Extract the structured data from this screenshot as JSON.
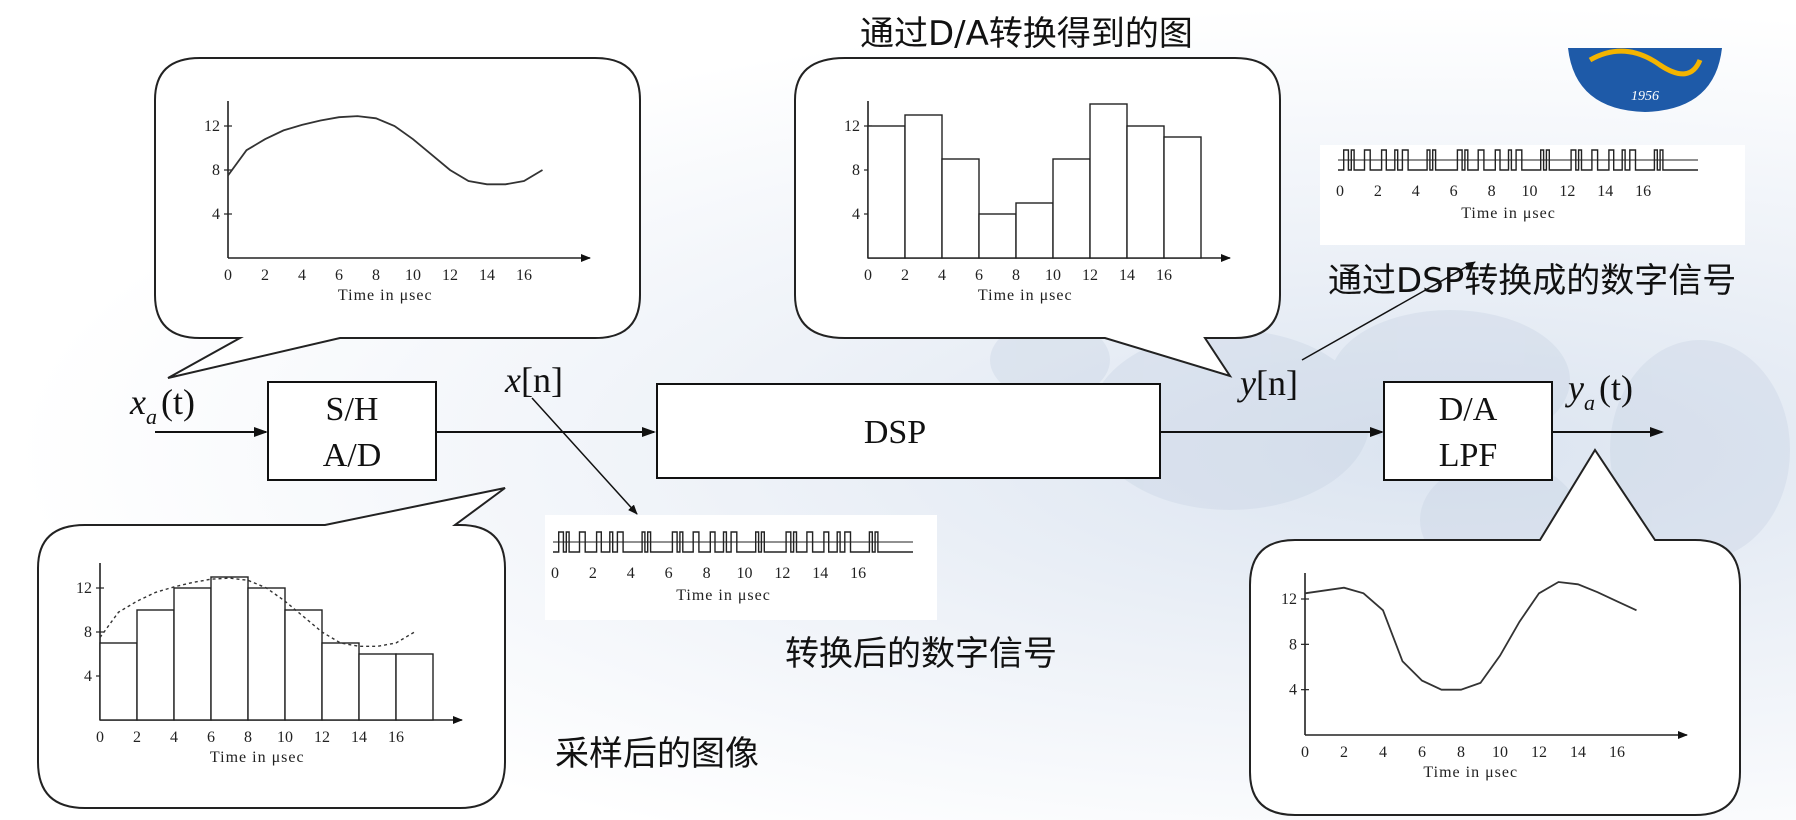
{
  "captions": {
    "da_graph": "通过D/A转换得到的图",
    "dsp_digital": "通过DSP转换成的数字信号",
    "converted_digital": "转换后的数字信号",
    "sampled_image": "采样后的图像"
  },
  "blocks": {
    "sh": {
      "line1": "S/H",
      "line2": "A/D"
    },
    "dsp": {
      "line1": "DSP"
    },
    "da": {
      "line1": "D/A",
      "line2": "LPF"
    }
  },
  "signals": {
    "xa": {
      "base": "x",
      "sub": "a",
      "arg": "(t)"
    },
    "xn": {
      "base": "x",
      "bracket": "[n]"
    },
    "yn": {
      "base": "y",
      "bracket": "[n]"
    },
    "ya": {
      "base": "y",
      "sub": "a",
      "arg": "(t)"
    }
  },
  "logo": {
    "year": "1956"
  },
  "plots": {
    "xticks": [
      "0",
      "2",
      "4",
      "6",
      "8",
      "10",
      "12",
      "14",
      "16"
    ],
    "yticks": [
      "4",
      "8",
      "12"
    ],
    "xlabel": "Time in μsec"
  },
  "chart_data": [
    {
      "type": "line",
      "name": "analog_input",
      "x": [
        0,
        1,
        2,
        3,
        4,
        5,
        6,
        7,
        8,
        9,
        10,
        11,
        12,
        13,
        14,
        15,
        16,
        17
      ],
      "y": [
        7.5,
        9.8,
        10.8,
        11.6,
        12.1,
        12.5,
        12.8,
        12.9,
        12.7,
        12.0,
        10.8,
        9.4,
        8.0,
        7.0,
        6.7,
        6.7,
        7.0,
        8.0
      ],
      "ylim": [
        0,
        15
      ],
      "xlim": [
        0,
        18
      ]
    },
    {
      "type": "bar",
      "name": "sampled",
      "categories": [
        "0",
        "2",
        "4",
        "6",
        "8",
        "10",
        "12",
        "14",
        "16"
      ],
      "values": [
        7,
        10,
        12,
        13,
        12,
        10,
        7,
        6,
        6
      ],
      "ylim": [
        0,
        15
      ],
      "xlim": [
        0,
        18
      ]
    },
    {
      "type": "bar",
      "name": "da_output",
      "categories": [
        "0",
        "2",
        "4",
        "6",
        "8",
        "10",
        "12",
        "14",
        "16"
      ],
      "values": [
        12,
        13,
        9,
        4,
        5,
        9,
        14,
        12,
        11
      ],
      "ylim": [
        0,
        15
      ],
      "xlim": [
        0,
        18
      ]
    },
    {
      "type": "line",
      "name": "lpf_output",
      "x": [
        0,
        2,
        3,
        4,
        5,
        6,
        7,
        8,
        9,
        10,
        11,
        12,
        13,
        14,
        15,
        16,
        17
      ],
      "y": [
        12.5,
        13,
        12.5,
        11.0,
        6.5,
        4.8,
        4.0,
        4.0,
        4.6,
        7.0,
        10.0,
        12.5,
        13.5,
        13.3,
        12.6,
        11.8,
        11.0
      ],
      "ylim": [
        0,
        15
      ],
      "xlim": [
        0,
        18
      ]
    }
  ]
}
